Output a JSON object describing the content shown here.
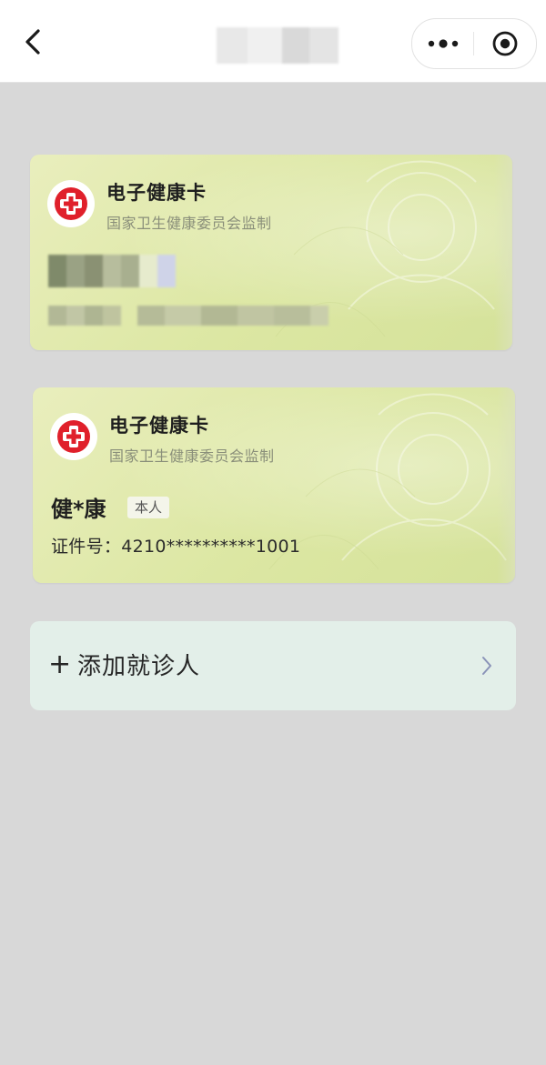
{
  "nav": {
    "back_icon": "chevron-left-icon",
    "more_icon": "more-dots-icon",
    "close_icon": "target-close-icon"
  },
  "cards": [
    {
      "title": "电子健康卡",
      "subtitle": "国家卫生健康委员会监制"
    },
    {
      "title": "电子健康卡",
      "subtitle": "国家卫生健康委员会监制",
      "holder_name": "健*康",
      "relation_tag": "本人",
      "id_label": "证件号：",
      "id_value": "4210**********1001"
    }
  ],
  "add_patient": {
    "plus": "+",
    "label": "添加就诊人"
  },
  "colors": {
    "page_bg": "#d8d8d8",
    "card_green": "#dde7a5",
    "add_bar_bg": "#e3efe9",
    "logo_red": "#e0202b"
  }
}
